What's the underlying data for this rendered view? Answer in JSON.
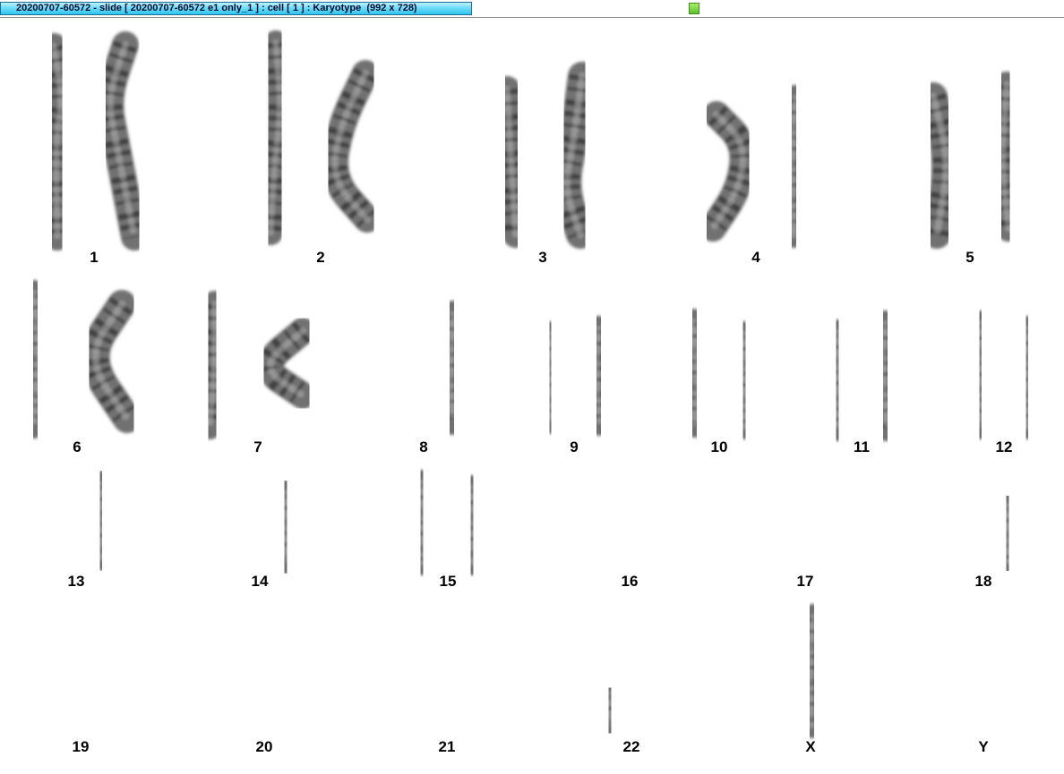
{
  "window": {
    "title": "20200707-60572 - slide [ 20200707-60572 e1 only_1 ] : cell [ 1 ] : Karyotype  (992 x 728)"
  },
  "colors": {
    "title_tab": "#43cdf2",
    "status_indicator": "#6fd13a",
    "chromosome": "#3a3a3a",
    "band": "#1a1a1a",
    "background": "#ffffff"
  },
  "chromosomes": [
    {
      "label": "1"
    },
    {
      "label": "2"
    },
    {
      "label": "3"
    },
    {
      "label": "4"
    },
    {
      "label": "5"
    },
    {
      "label": "6"
    },
    {
      "label": "7"
    },
    {
      "label": "8"
    },
    {
      "label": "9"
    },
    {
      "label": "10"
    },
    {
      "label": "11"
    },
    {
      "label": "12"
    },
    {
      "label": "13"
    },
    {
      "label": "14"
    },
    {
      "label": "15"
    },
    {
      "label": "16"
    },
    {
      "label": "17"
    },
    {
      "label": "18"
    },
    {
      "label": "19"
    },
    {
      "label": "20"
    },
    {
      "label": "21"
    },
    {
      "label": "22"
    },
    {
      "label": "X"
    },
    {
      "label": "Y"
    }
  ]
}
